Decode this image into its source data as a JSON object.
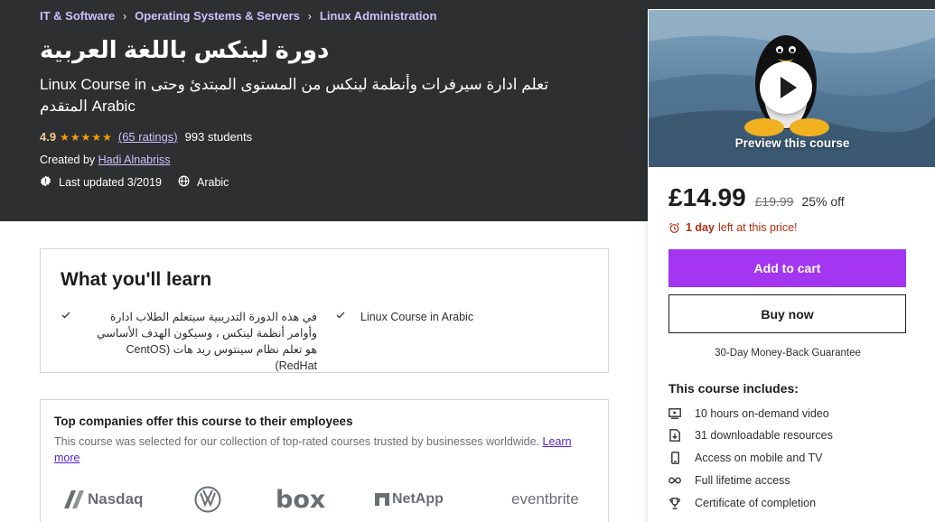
{
  "breadcrumbs": [
    "IT & Software",
    "Operating Systems & Servers",
    "Linux Administration"
  ],
  "breadcrumb_separator": "›",
  "course": {
    "title": "دورة لينكس باللغة العربية",
    "subtitle": "Linux Course in تعلم ادارة سيرفرات وأنظمة لينكس من المستوى المبتدئ وحتى المتقدم Arabic",
    "rating": "4.9",
    "stars": "★★★★★",
    "ratings_link": "(65 ratings)",
    "students": "993 students",
    "created_by_label": "Created by",
    "instructor": "Hadi Alnabriss",
    "last_updated": "Last updated 3/2019",
    "language": "Arabic"
  },
  "learn": {
    "heading": "What you'll learn",
    "items": [
      "في هذه الدورة التدريبية سيتعلم الطلاب ادارة وأوامر أنظمة لينكس ، وسيكون الهدف الأساسي هو تعلم نظام سينتوس ريد هات (CentOS RedHat)",
      "Linux Course in Arabic"
    ]
  },
  "companies": {
    "heading": "Top companies offer this course to their employees",
    "description": "This course was selected for our collection of top-rated courses trusted by businesses worldwide.",
    "learn_more": "Learn more",
    "logos": [
      "Nasdaq",
      "box",
      "NetApp",
      "eventbrite"
    ]
  },
  "sidebar": {
    "preview_label": "Preview this course",
    "price": "£14.99",
    "original_price": "£19.99",
    "discount": "25% off",
    "timer_bold": "1 day",
    "timer_rest": "left at this price!",
    "add_to_cart": "Add to cart",
    "buy_now": "Buy now",
    "guarantee": "30-Day Money-Back Guarantee",
    "includes_heading": "This course includes:",
    "includes": [
      {
        "icon": "video-icon",
        "label": "10 hours on-demand video"
      },
      {
        "icon": "file-download-icon",
        "label": "31 downloadable resources"
      },
      {
        "icon": "mobile-icon",
        "label": "Access on mobile and TV"
      },
      {
        "icon": "infinity-icon",
        "label": "Full lifetime access"
      },
      {
        "icon": "trophy-icon",
        "label": "Certificate of completion"
      }
    ]
  },
  "colors": {
    "hero_bg": "#2d2f31",
    "accent_purple": "#a435f0",
    "link_purple": "#cec0fc",
    "star_orange": "#f69c08",
    "timer_red": "#b32d0f"
  }
}
